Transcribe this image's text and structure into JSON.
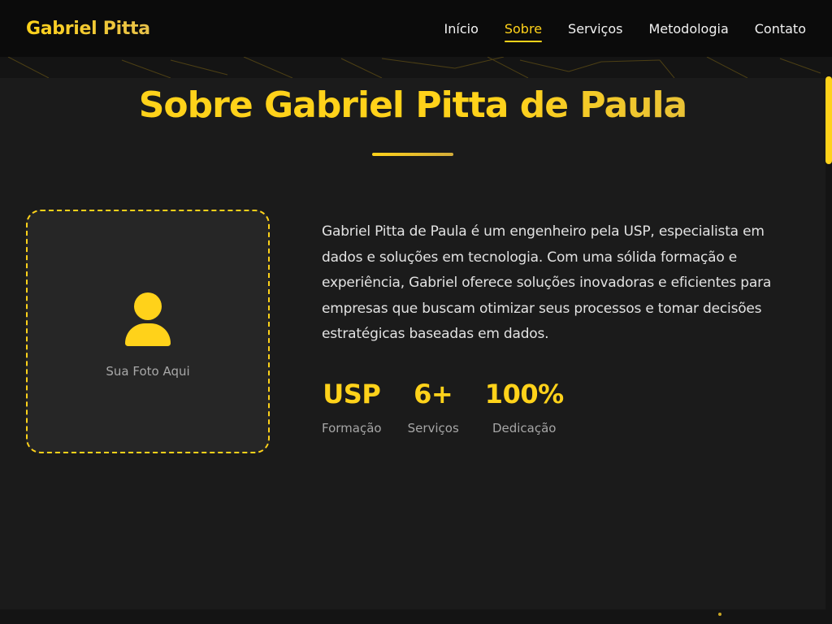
{
  "nav": {
    "brand": "Gabriel Pitta",
    "links": [
      {
        "label": "Início",
        "active": false
      },
      {
        "label": "Sobre",
        "active": true
      },
      {
        "label": "Serviços",
        "active": false
      },
      {
        "label": "Metodologia",
        "active": false
      },
      {
        "label": "Contato",
        "active": false
      }
    ]
  },
  "about": {
    "title": "Sobre Gabriel Pitta de Paula",
    "photo_caption": "Sua Foto Aqui",
    "photo_icon": "user-icon",
    "paragraph": "Gabriel Pitta de Paula é um engenheiro pela USP, especialista em dados e soluções em tecnologia. Com uma sólida formação e experiência, Gabriel oferece soluções inovadoras e eficientes para empresas que buscam otimizar seus processos e tomar decisões estratégicas baseadas em dados.",
    "stats": [
      {
        "value": "USP",
        "label": "Formação"
      },
      {
        "value": "6+",
        "label": "Serviços"
      },
      {
        "value": "100%",
        "label": "Dedicação"
      }
    ]
  },
  "colors": {
    "accent": "#ffd21a",
    "background": "#1b1b1b",
    "navbar": "#0b0b0b"
  }
}
